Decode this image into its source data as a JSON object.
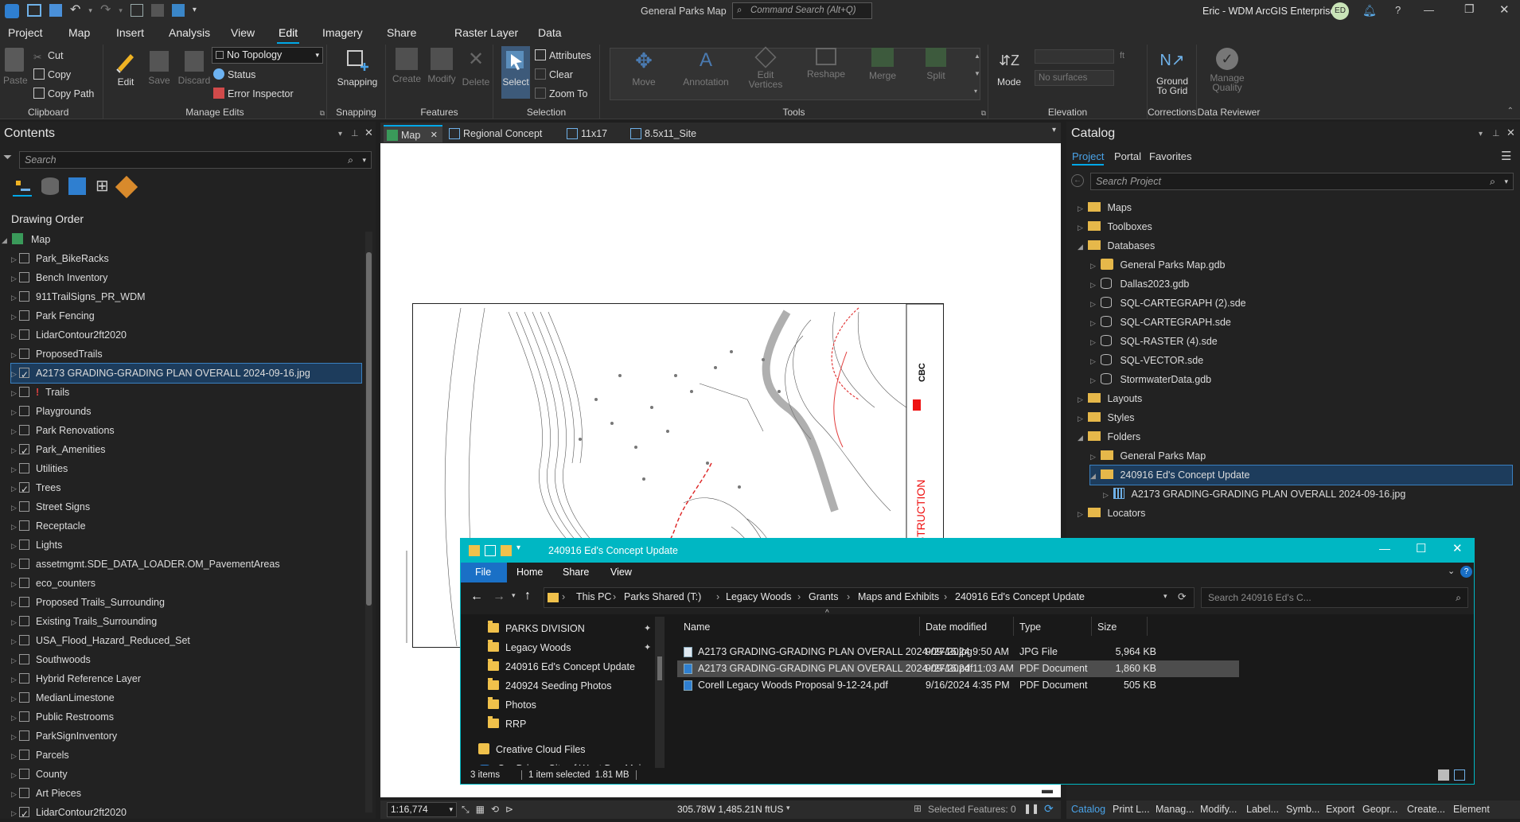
{
  "app": {
    "title": "General Parks Map",
    "command_search_placeholder": "Command Search (Alt+Q)",
    "user": "Eric - WDM ArcGIS Enterprise",
    "user_initials": "ED"
  },
  "ribbon_tabs": [
    "Project",
    "Map",
    "Insert",
    "Analysis",
    "View",
    "Edit",
    "Imagery",
    "Share"
  ],
  "active_tab": "Edit",
  "context_tabs": {
    "group": "Raster Layer",
    "tab": "Data"
  },
  "ribbon": {
    "clipboard": {
      "label": "Clipboard",
      "paste": "Paste",
      "cut": "Cut",
      "copy": "Copy",
      "copy_path": "Copy Path"
    },
    "manage_edits": {
      "label": "Manage Edits",
      "edit": "Edit",
      "save": "Save",
      "discard": "Discard",
      "topology": "No Topology",
      "status": "Status",
      "error_inspector": "Error Inspector"
    },
    "snapping": {
      "label": "Snapping",
      "button": "Snapping"
    },
    "features": {
      "label": "Features",
      "create": "Create",
      "modify": "Modify",
      "delete": "Delete"
    },
    "selection": {
      "label": "Selection",
      "select": "Select",
      "attributes": "Attributes",
      "clear": "Clear",
      "zoom_to": "Zoom To"
    },
    "tools": {
      "label": "Tools",
      "items": [
        "Move",
        "Annotation",
        "Edit Vertices",
        "Reshape",
        "Merge",
        "Split"
      ]
    },
    "elevation": {
      "label": "Elevation",
      "mode": "Mode",
      "surfaces_placeholder": "No surfaces",
      "unit": "ft"
    },
    "corrections": {
      "label": "Corrections",
      "ground_to_grid": "Ground To Grid"
    },
    "data_reviewer": {
      "label": "Data Reviewer",
      "manage_quality": "Manage Quality"
    }
  },
  "contents": {
    "title": "Contents",
    "search_placeholder": "Search",
    "drawing_order": "Drawing Order",
    "map_node": "Map",
    "layers": [
      {
        "name": "Park_BikeRacks",
        "checked": false
      },
      {
        "name": "Bench Inventory",
        "checked": false
      },
      {
        "name": "911TrailSigns_PR_WDM",
        "checked": false
      },
      {
        "name": "Park Fencing",
        "checked": false
      },
      {
        "name": "LidarContour2ft2020",
        "checked": false
      },
      {
        "name": "ProposedTrails",
        "checked": false
      },
      {
        "name": "A2173 GRADING-GRADING PLAN OVERALL 2024-09-16.jpg",
        "checked": true,
        "selected": true
      },
      {
        "name": "Trails",
        "checked": false,
        "warning": "!"
      },
      {
        "name": "Playgrounds",
        "checked": false
      },
      {
        "name": "Park Renovations",
        "checked": false
      },
      {
        "name": "Park_Amenities",
        "checked": true
      },
      {
        "name": "Utilities",
        "checked": false
      },
      {
        "name": "Trees",
        "checked": true
      },
      {
        "name": "Street Signs",
        "checked": false
      },
      {
        "name": "Receptacle",
        "checked": false
      },
      {
        "name": "Lights",
        "checked": false
      },
      {
        "name": "assetmgmt.SDE_DATA_LOADER.OM_PavementAreas",
        "checked": false
      },
      {
        "name": "eco_counters",
        "checked": false
      },
      {
        "name": "Proposed Trails_Surrounding",
        "checked": false
      },
      {
        "name": "Existing Trails_Surrounding",
        "checked": false
      },
      {
        "name": "USA_Flood_Hazard_Reduced_Set",
        "checked": false
      },
      {
        "name": "Southwoods",
        "checked": false
      },
      {
        "name": "Hybrid Reference Layer",
        "checked": false
      },
      {
        "name": "MedianLimestone",
        "checked": false
      },
      {
        "name": "Public Restrooms",
        "checked": false
      },
      {
        "name": "ParkSignInventory",
        "checked": false
      },
      {
        "name": "Parcels",
        "checked": false
      },
      {
        "name": "County",
        "checked": false
      },
      {
        "name": "Art Pieces",
        "checked": false
      },
      {
        "name": "LidarContour2ft2020",
        "checked": true
      }
    ]
  },
  "map_tabs": [
    "Map",
    "Regional Concept",
    "11x17",
    "8.5x11_Site"
  ],
  "map_sheet": {
    "stamp": "NOT FOR CONSTRUCTION",
    "logo": "CBC"
  },
  "map_status": {
    "scale": "1:16,774",
    "coords": "305.78W 1,485.21N ftUS",
    "selected": "Selected Features: 0"
  },
  "catalog": {
    "title": "Catalog",
    "tabs": [
      "Project",
      "Portal",
      "Favorites"
    ],
    "search_placeholder": "Search Project",
    "items": [
      {
        "label": "Maps",
        "level": 0,
        "exp": "▷",
        "icon": "folder"
      },
      {
        "label": "Toolboxes",
        "level": 0,
        "exp": "▷",
        "icon": "folder"
      },
      {
        "label": "Databases",
        "level": 0,
        "exp": "◢",
        "icon": "folder"
      },
      {
        "label": "General Parks Map.gdb",
        "level": 1,
        "exp": "▷",
        "icon": "gdb"
      },
      {
        "label": "Dallas2023.gdb",
        "level": 1,
        "exp": "▷",
        "icon": "db"
      },
      {
        "label": "SQL-CARTEGRAPH (2).sde",
        "level": 1,
        "exp": "▷",
        "icon": "db"
      },
      {
        "label": "SQL-CARTEGRAPH.sde",
        "level": 1,
        "exp": "▷",
        "icon": "db"
      },
      {
        "label": "SQL-RASTER (4).sde",
        "level": 1,
        "exp": "▷",
        "icon": "db"
      },
      {
        "label": "SQL-VECTOR.sde",
        "level": 1,
        "exp": "▷",
        "icon": "db"
      },
      {
        "label": "StormwaterData.gdb",
        "level": 1,
        "exp": "▷",
        "icon": "db"
      },
      {
        "label": "Layouts",
        "level": 0,
        "exp": "▷",
        "icon": "folder"
      },
      {
        "label": "Styles",
        "level": 0,
        "exp": "▷",
        "icon": "folder"
      },
      {
        "label": "Folders",
        "level": 0,
        "exp": "◢",
        "icon": "folder"
      },
      {
        "label": "General Parks Map",
        "level": 1,
        "exp": "▷",
        "icon": "folder"
      },
      {
        "label": "240916 Ed's Concept Update",
        "level": 1,
        "exp": "◢",
        "icon": "folder",
        "selected": true
      },
      {
        "label": "A2173 GRADING-GRADING PLAN OVERALL 2024-09-16.jpg",
        "level": 2,
        "exp": "▷",
        "icon": "raster"
      },
      {
        "label": "Locators",
        "level": 0,
        "exp": "▷",
        "icon": "folder"
      }
    ],
    "bottom_tabs": [
      "Catalog",
      "Print L...",
      "Manag...",
      "Modify...",
      "Label...",
      "Symb...",
      "Export",
      "Geopr...",
      "Create...",
      "Element"
    ]
  },
  "explorer": {
    "title": "240916 Ed's Concept Update",
    "menu": [
      "File",
      "Home",
      "Share",
      "View"
    ],
    "breadcrumb": [
      "This PC",
      "Parks Shared (T:)",
      "Legacy Woods",
      "Grants",
      "Maps and Exhibits",
      "240916 Ed's Concept Update"
    ],
    "search_placeholder": "Search 240916 Ed's C...",
    "nav": [
      {
        "label": "PARKS DIVISION",
        "pinned": true
      },
      {
        "label": "Legacy Woods",
        "pinned": true
      },
      {
        "label": "240916 Ed's Concept Update"
      },
      {
        "label": "240924 Seeding Photos"
      },
      {
        "label": "Photos"
      },
      {
        "label": "RRP"
      },
      {
        "label": "Creative Cloud Files"
      },
      {
        "label": "OneDrive - City of West Des Moines"
      }
    ],
    "columns": [
      "Name",
      "Date modified",
      "Type",
      "Size"
    ],
    "files": [
      {
        "name": "A2173 GRADING-GRADING PLAN OVERALL 2024-09-16.jpg",
        "date": "9/27/2024 9:50 AM",
        "type": "JPG File",
        "size": "5,964 KB"
      },
      {
        "name": "A2173 GRADING-GRADING PLAN OVERALL 2024-09-16.pdf",
        "date": "9/27/2024 11:03 AM",
        "type": "PDF Document",
        "size": "1,860 KB",
        "selected": true
      },
      {
        "name": "Corell Legacy Woods Proposal 9-12-24.pdf",
        "date": "9/16/2024 4:35 PM",
        "type": "PDF Document",
        "size": "505 KB"
      }
    ],
    "status": {
      "items": "3 items",
      "selected": "1 item selected  1.81 MB"
    }
  },
  "colors": {
    "accent": "#00a8e8",
    "explorer_accent": "#00b7c3",
    "selection": "#1d3c5c"
  }
}
